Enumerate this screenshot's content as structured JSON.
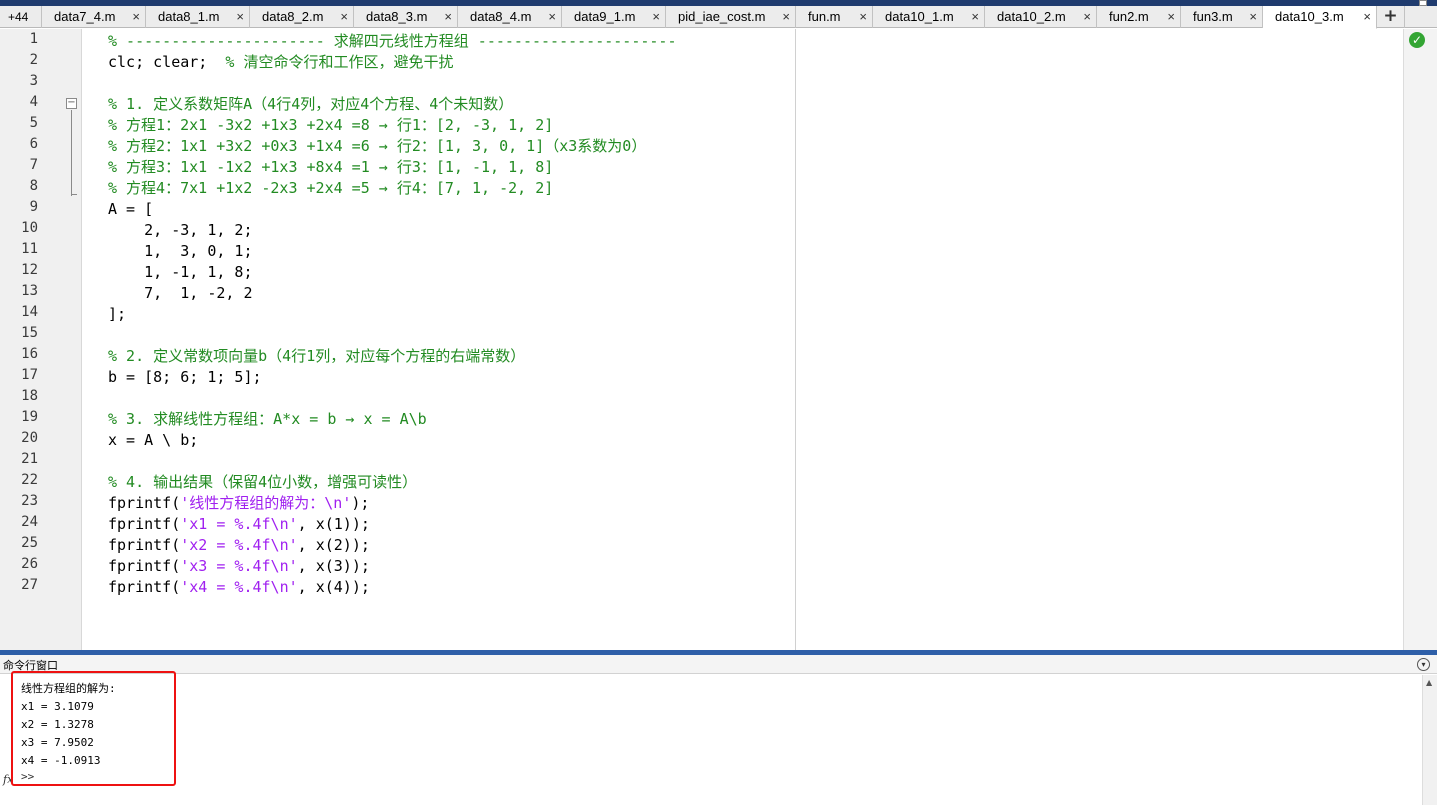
{
  "tabs": {
    "overflow_label": "+44",
    "items": [
      {
        "label": "data7_4.m"
      },
      {
        "label": "data8_1.m"
      },
      {
        "label": "data8_2.m"
      },
      {
        "label": "data8_3.m"
      },
      {
        "label": "data8_4.m"
      },
      {
        "label": "data9_1.m"
      },
      {
        "label": "pid_iae_cost.m"
      },
      {
        "label": "fun.m"
      },
      {
        "label": "data10_1.m"
      },
      {
        "label": "data10_2.m"
      },
      {
        "label": "fun2.m"
      },
      {
        "label": "fun3.m"
      },
      {
        "label": "data10_3.m"
      }
    ],
    "active_index": 12,
    "close_glyph": "×",
    "add_glyph": "+"
  },
  "editor": {
    "line_numbers": [
      "1",
      "2",
      "3",
      "4",
      "5",
      "6",
      "7",
      "8",
      "9",
      "10",
      "11",
      "12",
      "13",
      "14",
      "15",
      "16",
      "17",
      "18",
      "19",
      "20",
      "21",
      "22",
      "23",
      "24",
      "25",
      "26",
      "27"
    ],
    "fold_glyph": "−",
    "status_icon": "check-circle-icon",
    "lines": [
      [
        {
          "t": "% ---------------------- 求解四元线性方程组 ----------------------",
          "c": "cmt"
        }
      ],
      [
        {
          "t": "clc; clear;  ",
          "c": ""
        },
        {
          "t": "% 清空命令行和工作区，避免干扰",
          "c": "cmt"
        }
      ],
      [],
      [
        {
          "t": "% 1. 定义系数矩阵A（4行4列，对应4个方程、4个未知数）",
          "c": "cmt"
        }
      ],
      [
        {
          "t": "% 方程1：2x1 -3x2 +1x3 +2x4 =8 → 行1：[2, -3, 1, 2]",
          "c": "cmt"
        }
      ],
      [
        {
          "t": "% 方程2：1x1 +3x2 +0x3 +1x4 =6 → 行2：[1, 3, 0, 1]（x3系数为0）",
          "c": "cmt"
        }
      ],
      [
        {
          "t": "% 方程3：1x1 -1x2 +1x3 +8x4 =1 → 行3：[1, -1, 1, 8]",
          "c": "cmt"
        }
      ],
      [
        {
          "t": "% 方程4：7x1 +1x2 -2x3 +2x4 =5 → 行4：[7, 1, -2, 2]",
          "c": "cmt"
        }
      ],
      [
        {
          "t": "A = [",
          "c": ""
        }
      ],
      [
        {
          "t": "    2, -3, 1, 2;",
          "c": ""
        }
      ],
      [
        {
          "t": "    1,  3, 0, 1;",
          "c": ""
        }
      ],
      [
        {
          "t": "    1, -1, 1, 8;",
          "c": ""
        }
      ],
      [
        {
          "t": "    7,  1, -2, 2",
          "c": ""
        }
      ],
      [
        {
          "t": "];",
          "c": ""
        }
      ],
      [],
      [
        {
          "t": "% 2. 定义常数项向量b（4行1列，对应每个方程的右端常数）",
          "c": "cmt"
        }
      ],
      [
        {
          "t": "b = [8; 6; 1; 5];",
          "c": ""
        }
      ],
      [],
      [
        {
          "t": "% 3. 求解线性方程组：A*x = b → x = A\\b",
          "c": "cmt"
        }
      ],
      [
        {
          "t": "x = A \\ b;",
          "c": ""
        }
      ],
      [],
      [
        {
          "t": "% 4. 输出结果（保留4位小数，增强可读性）",
          "c": "cmt"
        }
      ],
      [
        {
          "t": "fprintf(",
          "c": ""
        },
        {
          "t": "'线性方程组的解为：\\n'",
          "c": "str"
        },
        {
          "t": ");",
          "c": ""
        }
      ],
      [
        {
          "t": "fprintf(",
          "c": ""
        },
        {
          "t": "'x1 = %.4f\\n'",
          "c": "str"
        },
        {
          "t": ", x(1));",
          "c": ""
        }
      ],
      [
        {
          "t": "fprintf(",
          "c": ""
        },
        {
          "t": "'x2 = %.4f\\n'",
          "c": "str"
        },
        {
          "t": ", x(2));",
          "c": ""
        }
      ],
      [
        {
          "t": "fprintf(",
          "c": ""
        },
        {
          "t": "'x3 = %.4f\\n'",
          "c": "str"
        },
        {
          "t": ", x(3));",
          "c": ""
        }
      ],
      [
        {
          "t": "fprintf(",
          "c": ""
        },
        {
          "t": "'x4 = %.4f\\n'",
          "c": "str"
        },
        {
          "t": ", x(4));",
          "c": ""
        }
      ]
    ]
  },
  "command_window": {
    "title": "命令行窗口",
    "menu_icon": "chevron-down-circle-icon",
    "fx_label": "fx",
    "output_lines": [
      "线性方程组的解为:",
      "x1 = 3.1079",
      "x2 = 1.3278",
      "x3 = 7.9502",
      "x4 = -1.0913"
    ],
    "prompt": ">>"
  },
  "colors": {
    "comment": "#228b22",
    "string": "#a020f0",
    "highlight_border": "#ee1111",
    "separator": "#2e5fa8"
  }
}
